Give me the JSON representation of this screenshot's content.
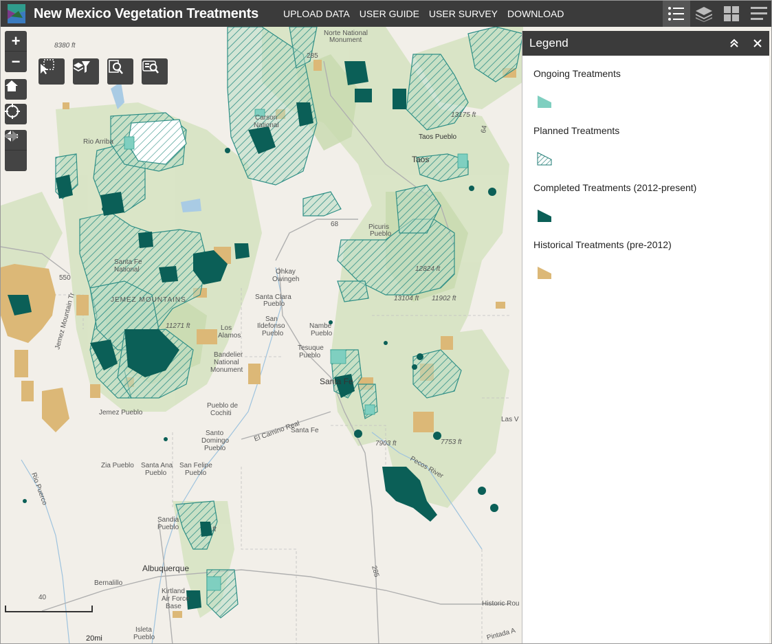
{
  "header": {
    "title": "New Mexico Vegetation Treatments",
    "nav": [
      "UPLOAD DATA",
      "USER GUIDE",
      "USER SURVEY",
      "DOWNLOAD"
    ],
    "icons": [
      "legend-list-icon",
      "layers-icon",
      "grid-icon",
      "menu-icon"
    ]
  },
  "controls": {
    "zoom_in": "+",
    "zoom_out": "−"
  },
  "legend": {
    "title": "Legend",
    "items": [
      {
        "label": "Ongoing Treatments",
        "color": "#7fcfc0",
        "pattern": "solid"
      },
      {
        "label": "Planned Treatments",
        "color": "#1f7b74",
        "pattern": "hatch"
      },
      {
        "label": "Completed Treatments (2012-present)",
        "color": "#0b5f57",
        "pattern": "solid"
      },
      {
        "label": "Historical Treatments (pre-2012)",
        "color": "#dcb877",
        "pattern": "solid"
      }
    ]
  },
  "map": {
    "places": [
      "Taos Pueblo",
      "Taos",
      "Picuris Pueblo",
      "Ohkay Owingeh",
      "Santa Clara Pueblo",
      "San Ildefonso Pueblo",
      "Nambe Pueblo",
      "Tesuque Pueblo",
      "Santa Fe",
      "Los Alamos",
      "Pueblo de Cochiti",
      "Jemez Pueblo",
      "Santo Domingo Pueblo",
      "Zia Pueblo",
      "Santa Ana Pueblo",
      "San Felipe Pueblo",
      "Sandia Pueblo",
      "Albuquerque",
      "Bernalillo",
      "Kirtland Air Force Base",
      "Isleta Pueblo",
      "Las V",
      "Norte National Monument",
      "Carson National",
      "Santa Fe National",
      "Bandelier National Monument",
      "Rio Arriba"
    ],
    "elevations": [
      "8380 ft",
      "13175 ft",
      "12824 ft",
      "13104 ft",
      "11902 ft",
      "11271 ft",
      "7903 ft",
      "7753 ft",
      "ft"
    ],
    "features": [
      "JEMEZ MOUNTAINS",
      "Jemez Mountain Tr",
      "El Camino Real",
      "Santa Fe",
      "Pecos River",
      "Rio Puerco",
      "Historic Rou",
      "Pintada A"
    ],
    "roads": [
      "285",
      "64",
      "68",
      "550",
      "40",
      "285"
    ]
  },
  "scale": {
    "label": "20mi"
  }
}
